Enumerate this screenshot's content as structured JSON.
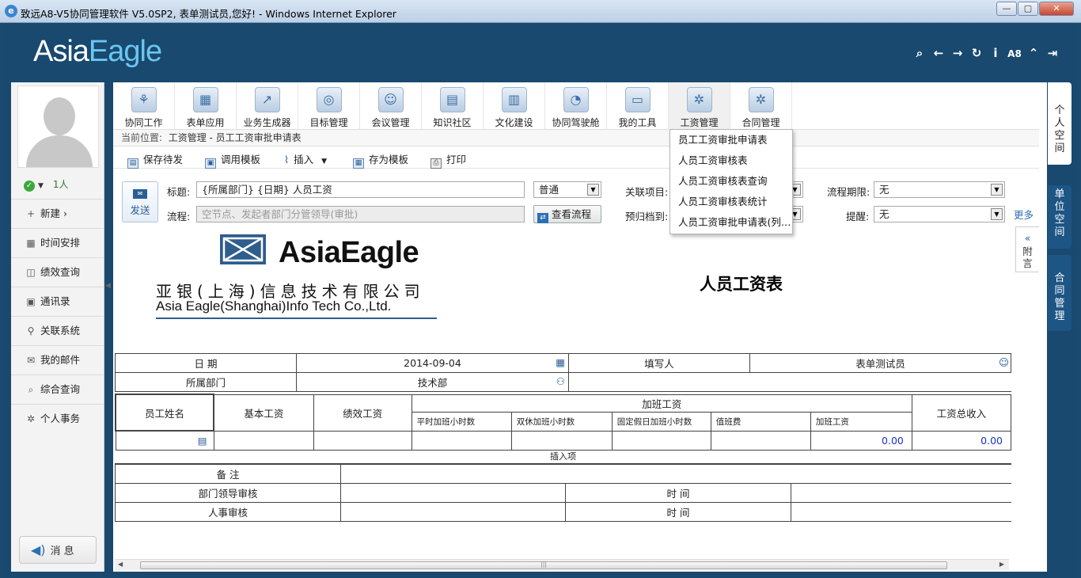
{
  "window": {
    "title": "致远A8-V5协同管理软件 V5.0SP2, 表单测试员,您好! - Windows Internet Explorer"
  },
  "header": {
    "logo_a": "Asia",
    "logo_b": "Eagle",
    "icons": [
      "search-icon",
      "back-icon",
      "forward-icon",
      "refresh-icon",
      "info-icon",
      "a8-icon",
      "collapse-up-icon",
      "logout-icon"
    ],
    "a8_label": "A8"
  },
  "user": {
    "online_count": "1人"
  },
  "sidebar": {
    "new_label": "新建",
    "items": [
      {
        "icon": "calendar-icon",
        "glyph": "▦",
        "label": "时间安排"
      },
      {
        "icon": "performance-icon",
        "glyph": "◫",
        "label": "绩效查询"
      },
      {
        "icon": "contacts-icon",
        "glyph": "▣",
        "label": "通讯录"
      },
      {
        "icon": "link-icon",
        "glyph": "⚲",
        "label": "关联系统"
      },
      {
        "icon": "mail-icon",
        "glyph": "✉",
        "label": "我的邮件"
      },
      {
        "icon": "search-icon",
        "glyph": "⌕",
        "label": "综合查询"
      },
      {
        "icon": "gear-icon",
        "glyph": "✲",
        "label": "个人事务"
      }
    ],
    "message_label": "消 息"
  },
  "apps": [
    {
      "label": "协同工作",
      "icon": "collaboration-icon",
      "glyph": "⚘"
    },
    {
      "label": "表单应用",
      "icon": "form-icon",
      "glyph": "▦"
    },
    {
      "label": "业务生成器",
      "icon": "business-generator-icon",
      "glyph": "↗"
    },
    {
      "label": "目标管理",
      "icon": "target-icon",
      "glyph": "◎"
    },
    {
      "label": "会议管理",
      "icon": "meeting-icon",
      "glyph": "☺"
    },
    {
      "label": "知识社区",
      "icon": "knowledge-icon",
      "glyph": "▤"
    },
    {
      "label": "文化建设",
      "icon": "culture-icon",
      "glyph": "▥"
    },
    {
      "label": "协同驾驶舱",
      "icon": "cockpit-icon",
      "glyph": "◔"
    },
    {
      "label": "我的工具",
      "icon": "toolbox-icon",
      "glyph": "▭"
    },
    {
      "label": "工资管理",
      "icon": "salary-gear-icon",
      "glyph": "✲"
    },
    {
      "label": "合同管理",
      "icon": "contract-gear-icon",
      "glyph": "✲"
    }
  ],
  "breadcrumb": {
    "prefix": "当前位置:",
    "path": "工资管理 - 员工工资审批申请表"
  },
  "toolbar": {
    "save_draft": "保存待发",
    "use_template": "调用模板",
    "insert": "插入",
    "save_as_template": "存为模板",
    "print": "打印"
  },
  "compose": {
    "send": "发送",
    "title_label": "标题:",
    "title_value": "{所属部门} {日期} 人员工资",
    "priority": "普通",
    "related_label": "关联项目:",
    "deadline_label": "流程期限:",
    "deadline_value": "无",
    "flow_label": "流程:",
    "flow_placeholder": "空节点、发起者部门分管领导(审批)",
    "view_flow": "查看流程",
    "archive_label": "预归档到:",
    "remind_label": "提醒:",
    "remind_value": "无",
    "more": "更多"
  },
  "dropdown_menu": [
    "员工工资审批申请表",
    "人员工资审核表",
    "人员工资审核表查询",
    "人员工资审核表统计",
    "人员工资审批申请表(列…"
  ],
  "attach_tab": {
    "label": "附言",
    "icon": "double-chevron-left-icon"
  },
  "right_tabs": [
    "个人空间",
    "单位空间",
    "合同管理"
  ],
  "form": {
    "brand": "AsiaEagle",
    "company_cn": "亚银(上海)信息技术有限公司",
    "company_en": "Asia Eagle(Shanghai)Info Tech Co.,Ltd.",
    "title": "人员工资表",
    "date_label": "日      期",
    "date_value": "2014-09-04",
    "filler_label": "填写人",
    "filler_value": "表单测试员",
    "dept_label": "所属部门",
    "dept_value": "技术部",
    "col_name": "员工姓名",
    "col_base": "基本工资",
    "col_perf": "绩效工资",
    "col_overtime": "加班工资",
    "col_total": "工资总收入",
    "sub_cols": [
      "平时加班小时数",
      "双休加班小时数",
      "固定假日加班小时数",
      "值班费",
      "加班工资"
    ],
    "overtime_value": "0.00",
    "total_value": "0.00",
    "insert_item": "插入项",
    "remark_label": "备      注",
    "dept_leader_label": "部门领导审核",
    "hr_label": "人事审核",
    "time_label": "时      间"
  },
  "colors": {
    "frame": "#19496f",
    "logo_accent": "#6bc6f0",
    "link": "#2b6fb4",
    "value_blue": "#1a33c8"
  }
}
